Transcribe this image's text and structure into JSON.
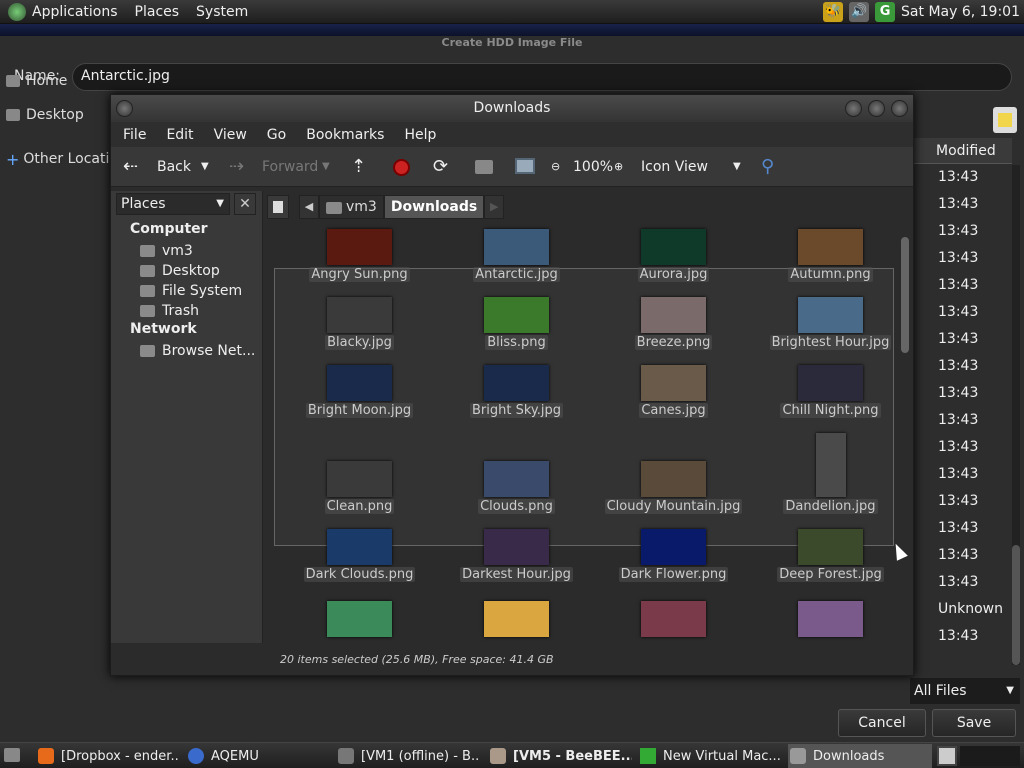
{
  "top_panel": {
    "menus": [
      "Applications",
      "Places",
      "System"
    ],
    "clock": "Sat May  6, 19:01"
  },
  "save_dialog": {
    "title": "Create HDD Image File",
    "name_label": "Name:",
    "name_value": "Antarctic.jpg",
    "places": [
      "Home",
      "Desktop"
    ],
    "other_locations": "Other Locations",
    "modified_header": "Modified",
    "modified_values": [
      "13:43",
      "13:43",
      "13:43",
      "13:43",
      "13:43",
      "13:43",
      "13:43",
      "13:43",
      "13:43",
      "13:43",
      "13:43",
      "13:43",
      "13:43",
      "13:43",
      "13:43",
      "13:43",
      "Unknown",
      "13:43"
    ],
    "filter": "All Files",
    "cancel": "Cancel",
    "save": "Save"
  },
  "downloads_window": {
    "title": "Downloads",
    "menu": [
      "File",
      "Edit",
      "View",
      "Go",
      "Bookmarks",
      "Help"
    ],
    "toolbar": {
      "back": "Back",
      "forward": "Forward",
      "zoom": "100%",
      "view_mode": "Icon View"
    },
    "sidebar": {
      "combo": "Places",
      "computer_header": "Computer",
      "computer_items": [
        "vm3",
        "Desktop",
        "File System",
        "Trash"
      ],
      "network_header": "Network",
      "network_items": [
        "Browse Net..."
      ]
    },
    "breadcrumb": [
      "vm3",
      "Downloads"
    ],
    "files": [
      {
        "name": "Angry Sun.png",
        "color": "#5a1a10"
      },
      {
        "name": "Antarctic.jpg",
        "color": "#3b5a7a"
      },
      {
        "name": "Aurora.jpg",
        "color": "#0f3a2a"
      },
      {
        "name": "Autumn.png",
        "color": "#6a4a2a"
      },
      {
        "name": "Blacky.jpg",
        "color": "#3a3a3a"
      },
      {
        "name": "Bliss.png",
        "color": "#3a7a2a"
      },
      {
        "name": "Breeze.png",
        "color": "#7a6a6a"
      },
      {
        "name": "Brightest Hour.jpg",
        "color": "#4a6a8a"
      },
      {
        "name": "Bright Moon.jpg",
        "color": "#1a2a4a"
      },
      {
        "name": "Bright Sky.jpg",
        "color": "#1a2a4a"
      },
      {
        "name": "Canes.jpg",
        "color": "#6a5a4a"
      },
      {
        "name": "Chill Night.png",
        "color": "#2a2a3a"
      },
      {
        "name": "Clean.png",
        "color": "#3a3a3a"
      },
      {
        "name": "Clouds.png",
        "color": "#3a4a6a"
      },
      {
        "name": "Cloudy Mountain.jpg",
        "color": "#5a4a3a"
      },
      {
        "name": "Dandelion.jpg",
        "color": "#4a4a4a"
      },
      {
        "name": "Dark Clouds.png",
        "color": "#1a3a6a"
      },
      {
        "name": "Darkest Hour.jpg",
        "color": "#3a2a4a"
      },
      {
        "name": "Dark Flower.png",
        "color": "#0a1a6a"
      },
      {
        "name": "Deep Forest.jpg",
        "color": "#3a4a2a"
      }
    ],
    "status": "20 items selected (25.6 MB), Free space: 41.4 GB"
  },
  "taskbar": {
    "tasks": [
      "[Dropbox - ender...",
      "AQEMU",
      "[VM1 (offline) - B...",
      "[VM5 - BeeBEE...",
      "New Virtual Mac...",
      "Downloads"
    ]
  }
}
